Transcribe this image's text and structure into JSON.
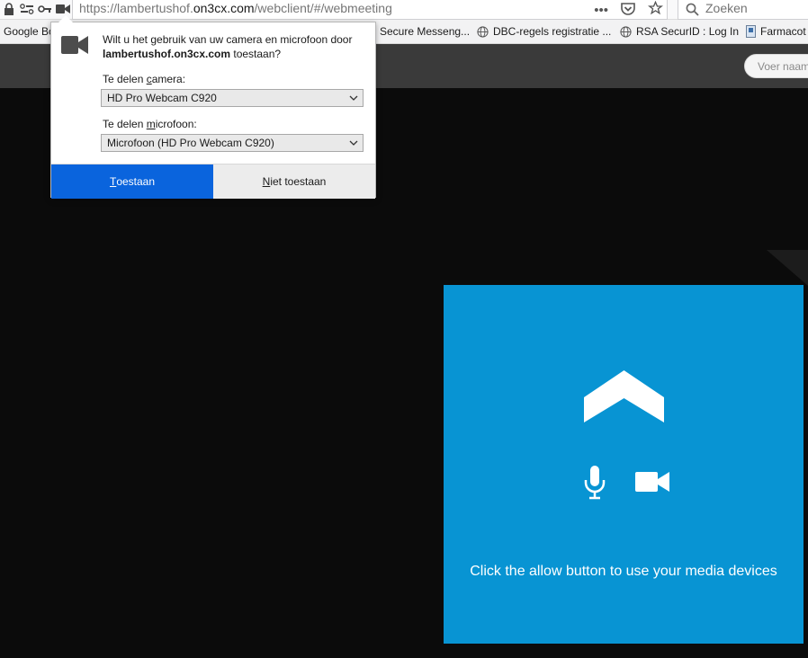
{
  "browser": {
    "url_prefix": "https://lambertushof.",
    "url_domain": "on3cx.com",
    "url_suffix": "/webclient/#/webmeeting",
    "overflow_icon": "ellipsis-icon",
    "search_placeholder": "Zoeken"
  },
  "bookmarks": [
    {
      "label": "Google Bo"
    },
    {
      "label": "Secure Messeng..."
    },
    {
      "label": "DBC-regels registratie ..."
    },
    {
      "label": "RSA SecurID : Log In"
    },
    {
      "label": "Farmacot"
    }
  ],
  "app": {
    "name_input_placeholder": "Voer naam"
  },
  "permission_popup": {
    "question_line1": "Wilt u het gebruik van uw camera en microfoon door",
    "question_site": "lambertushof.on3cx.com",
    "question_end": " toestaan?",
    "camera_label_pre": "Te delen ",
    "camera_label_key": "c",
    "camera_label_post": "amera:",
    "camera_value": "HD Pro Webcam C920",
    "mic_label_pre": "Te delen ",
    "mic_label_key": "m",
    "mic_label_post": "icrofoon:",
    "mic_value": "Microfoon (HD Pro Webcam C920)",
    "allow_key": "T",
    "allow_rest": "oestaan",
    "deny_key": "N",
    "deny_rest": "iet toestaan"
  },
  "media_panel": {
    "message": "Click the allow button to use your media devices",
    "color": "#0894d3"
  },
  "colors": {
    "allow_button": "#0a64dd",
    "background": "#0b0b0b",
    "header": "#3a3a3a"
  }
}
